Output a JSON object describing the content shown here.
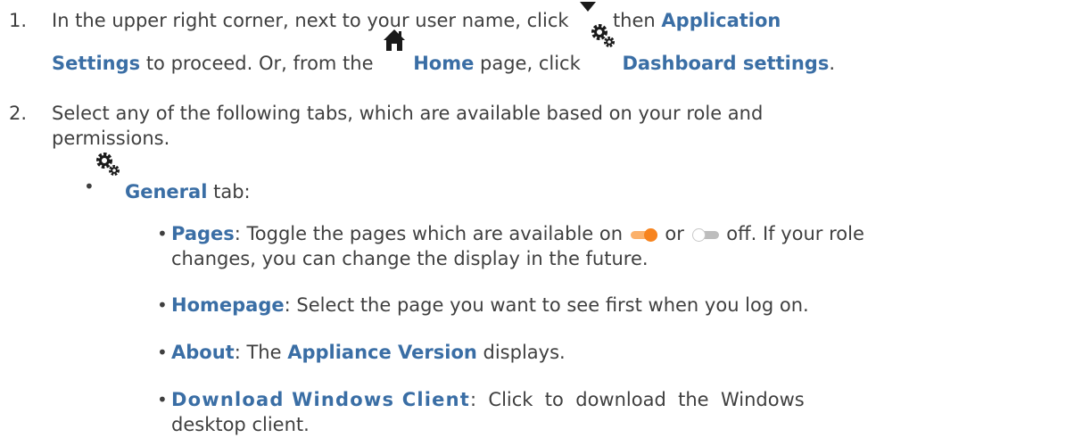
{
  "steps": [
    {
      "number": "1.",
      "line1": {
        "text_a": "In the upper right corner, next to your user name, click",
        "text_b": "then",
        "bold_a": "Application"
      },
      "line2": {
        "bold_a": "Settings",
        "text_a": "to proceed. Or, from the",
        "bold_b": "Home",
        "text_b": "page, click",
        "bold_c": "Dashboard settings",
        "text_c": "."
      }
    },
    {
      "number": "2.",
      "line1": "Select any of the following tabs, which are available based on your role and",
      "line2": "permissions."
    }
  ],
  "general_tab": {
    "bold": "General",
    "text": "tab:"
  },
  "sub_items": {
    "pages": {
      "bold": "Pages",
      "text_a": ": Toggle the pages which are available on",
      "text_b": "or",
      "text_c": "off. If your role",
      "line2": "changes, you can change the display in the future."
    },
    "homepage": {
      "bold": "Homepage",
      "text": ": Select the page you want to see first when you log on."
    },
    "about": {
      "bold": "About",
      "text_a": ": The",
      "bold_b": "Appliance Version",
      "text_b": "displays."
    },
    "download": {
      "bold": "Download Windows Client",
      "text": ":  Click  to  download  the  Windows",
      "line2": "desktop client."
    }
  },
  "colors": {
    "text": "#3f3f3f",
    "accent": "#3a6ea5",
    "toggle_on": "#f7831e",
    "toggle_off": "#d0d0d0"
  },
  "icons": [
    "caret-down-icon",
    "home-icon",
    "gears-icon",
    "toggle-on-icon",
    "toggle-off-icon"
  ]
}
